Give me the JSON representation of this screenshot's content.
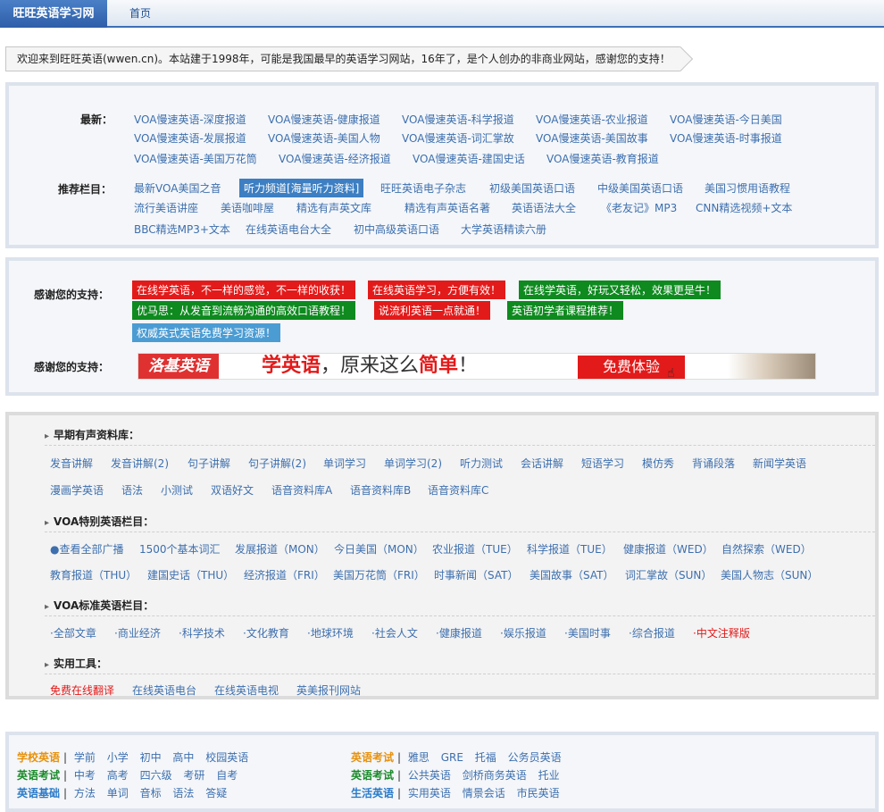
{
  "nav": {
    "brand": "旺旺英语学习网",
    "home": "首页"
  },
  "welcome": "欢迎来到旺旺英语(wwen.cn)。本站建于1998年，可能是我国最早的英语学习网站，16年了，是个人创办的非商业网站，感谢您的支持！",
  "latest": {
    "label": "最新：",
    "items": [
      "VOA慢速英语-深度报道",
      "VOA慢速英语-健康报道",
      "VOA慢速英语-科学报道",
      "VOA慢速英语-农业报道",
      "VOA慢速英语-今日美国",
      "VOA慢速英语-发展报道",
      "VOA慢速英语-美国人物",
      "VOA慢速英语-词汇掌故",
      "VOA慢速英语-美国故事",
      "VOA慢速英语-时事报道",
      "VOA慢速英语-美国万花筒",
      "VOA慢速英语-经济报道",
      "VOA慢速英语-建国史话",
      "VOA慢速英语-教育报道"
    ]
  },
  "recommended": {
    "label": "推荐栏目：",
    "items": [
      "最新VOA美国之音",
      "听力频道[海量听力资料]",
      "旺旺英语电子杂志",
      "初级美国英语口语",
      "中级美国英语口语",
      "美国习惯用语教程",
      "流行美语讲座",
      "美语咖啡屋",
      "精选有声英文库",
      "精选有声英语名著",
      "英语语法大全",
      "《老友记》MP3",
      "CNN精选视频+文本",
      "BBC精选MP3+文本",
      "在线英语电台大全",
      "初中高级英语口语",
      "大学英语精读六册"
    ]
  },
  "support": {
    "label": "感谢您的支持：",
    "tags": [
      "在线学英语，不一样的感觉，不一样的收获！",
      "在线英语学习，方便有效！",
      "在线学英语，好玩又轻松，效果更是牛！",
      "优马思：从发音到流畅沟通的高效口语教程！",
      "说流利英语一点就通！",
      "英语初学者课程推荐！",
      "权威英式英语免费学习资源！"
    ],
    "label2": "感谢您的支持：",
    "banner": {
      "logo": "洛基英语",
      "slogan_a": "学英语",
      "slogan_b": "，原来这么",
      "slogan_c": "简单",
      "slogan_d": "！",
      "button": "免费体验"
    }
  },
  "early": {
    "title": "早期有声资料库：",
    "items": [
      "发音讲解",
      "发音讲解(2)",
      "句子讲解",
      "句子讲解(2)",
      "单词学习",
      "单词学习(2)",
      "听力测试",
      "会话讲解",
      "短语学习",
      "模仿秀",
      "背诵段落",
      "新闻学英语",
      "漫画学英语",
      "语法",
      "小测试",
      "双语好文",
      "语音资料库A",
      "语音资料库B",
      "语音资料库C"
    ]
  },
  "voa_special": {
    "title": "VOA特别英语栏目：",
    "items": [
      "●查看全部广播",
      "1500个基本词汇",
      "发展报道（MON）",
      "今日美国（MON）",
      "农业报道（TUE）",
      "科学报道（TUE）",
      "健康报道（WED）",
      "自然探索（WED）",
      "教育报道（THU）",
      "建国史话（THU）",
      "经济报道（FRI）",
      "美国万花筒（FRI）",
      "时事新闻（SAT）",
      "美国故事（SAT）",
      "词汇掌故（SUN）",
      "美国人物志（SUN）"
    ]
  },
  "voa_standard": {
    "title": "VOA标准英语栏目：",
    "items": [
      "·全部文章",
      "·商业经济",
      "·科学技术",
      "·文化教育",
      "·地球环境",
      "·社会人文",
      "·健康报道",
      "·娱乐报道",
      "·美国时事",
      "·综合报道",
      "·中文注释版"
    ]
  },
  "tools": {
    "title": "实用工具：",
    "items": [
      "免费在线翻译",
      "在线英语电台",
      "在线英语电视",
      "英美报刊网站"
    ]
  },
  "cats": {
    "left": [
      {
        "name": "学校英语",
        "items": [
          "学前",
          "小学",
          "初中",
          "高中",
          "校园英语"
        ]
      },
      {
        "name": "英语考试",
        "items": [
          "中考",
          "高考",
          "四六级",
          "考研",
          "自考"
        ]
      },
      {
        "name": "英语基础",
        "items": [
          "方法",
          "单词",
          "音标",
          "语法",
          "答疑"
        ]
      }
    ],
    "right": [
      {
        "name": "英语考试",
        "items": [
          "雅思",
          "GRE",
          "托福",
          "公务员英语"
        ]
      },
      {
        "name": "英语考试",
        "items": [
          "公共英语",
          "剑桥商务英语",
          "托业"
        ]
      },
      {
        "name": "生活英语",
        "items": [
          "实用英语",
          "情景会话",
          "市民英语"
        ]
      }
    ]
  },
  "colors": {
    "brand": "#2e5ea8",
    "link": "#3d6fae",
    "red": "#e31a1a",
    "green": "#0e8a1f"
  }
}
